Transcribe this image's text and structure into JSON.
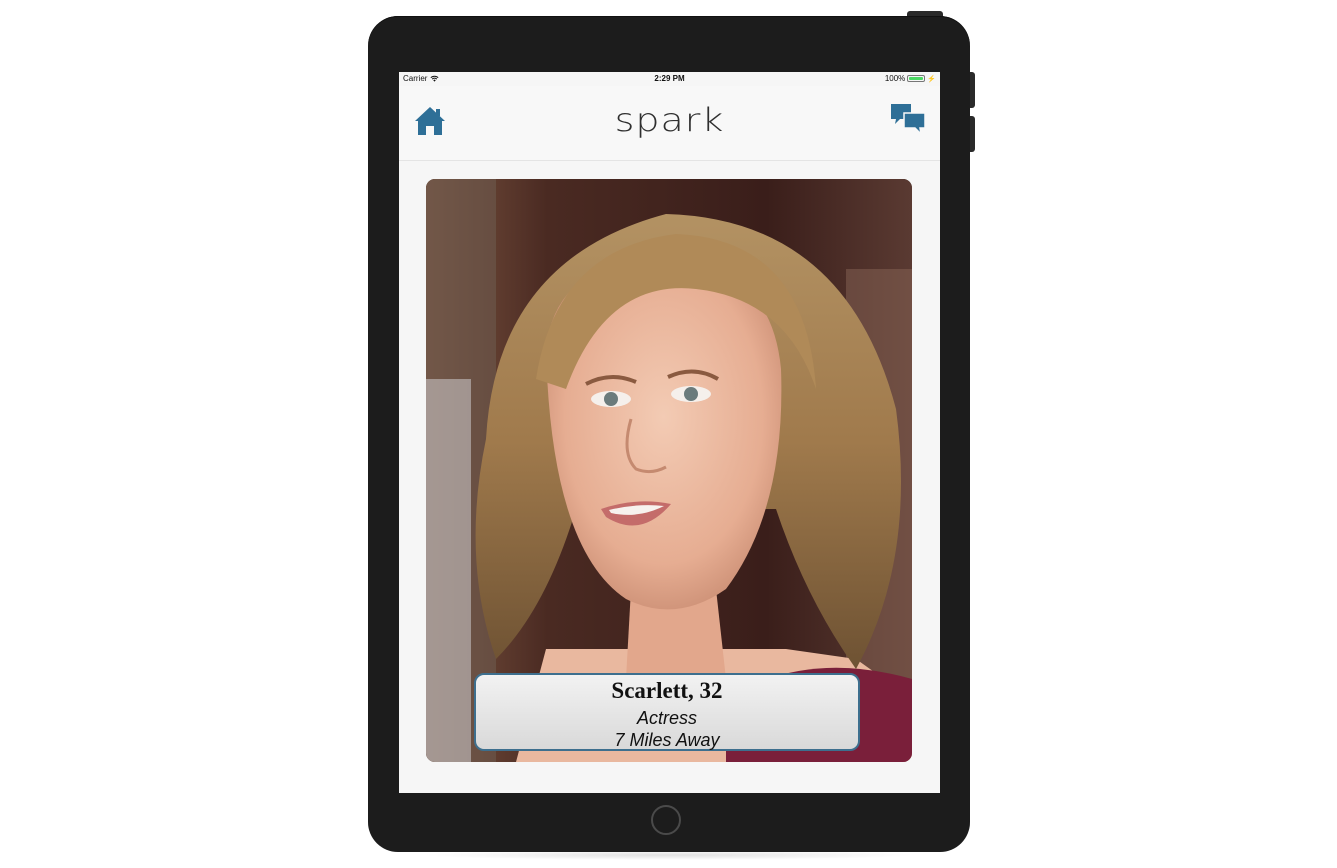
{
  "status_bar": {
    "carrier": "Carrier",
    "time": "2:29 PM",
    "battery": "100%",
    "battery_level": 1.0
  },
  "nav": {
    "title": "spark",
    "home_icon": "home-icon",
    "chat_icon": "chat-bubbles-icon",
    "accent_color": "#2e6f97"
  },
  "profile": {
    "name_age": "Scarlett, 32",
    "occupation": "Actress",
    "distance": "7 Miles Away",
    "border_color": "#3d6f8e"
  }
}
